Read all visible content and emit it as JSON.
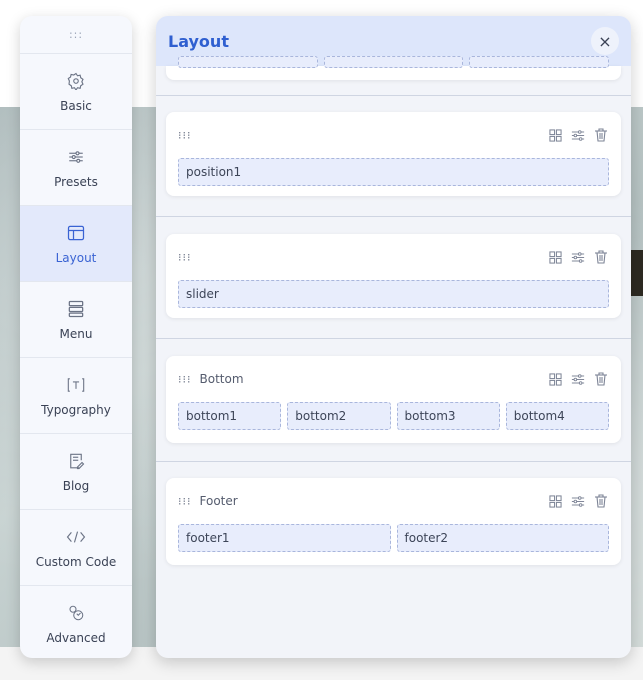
{
  "sidebar": {
    "handle": ":::",
    "items": [
      {
        "label": "Basic",
        "icon": "gear-icon"
      },
      {
        "label": "Presets",
        "icon": "sliders-icon"
      },
      {
        "label": "Layout",
        "icon": "layout-icon",
        "active": true
      },
      {
        "label": "Menu",
        "icon": "menu-icon"
      },
      {
        "label": "Typography",
        "icon": "text-icon"
      },
      {
        "label": "Blog",
        "icon": "blog-icon"
      },
      {
        "label": "Custom Code",
        "icon": "code-icon"
      },
      {
        "label": "Advanced",
        "icon": "advanced-icon"
      }
    ]
  },
  "panel": {
    "title": "Layout",
    "close_label": "×",
    "sections": [
      {
        "title": "",
        "positions": [
          "position1"
        ]
      },
      {
        "title": "",
        "positions": [
          "slider"
        ]
      },
      {
        "title": "Bottom",
        "positions": [
          "bottom1",
          "bottom2",
          "bottom3",
          "bottom4"
        ]
      },
      {
        "title": "Footer",
        "positions": [
          "footer1",
          "footer2"
        ]
      }
    ]
  },
  "colors": {
    "accent": "#2f5fd0",
    "active_bg": "#e3e9fb",
    "position_bg": "#e8edfc"
  }
}
